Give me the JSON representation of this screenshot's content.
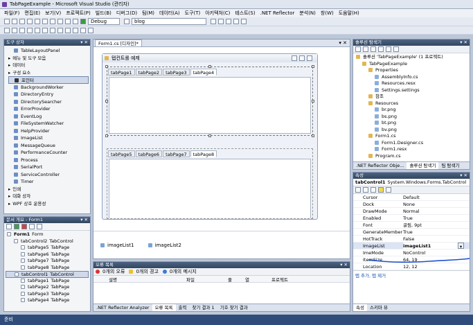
{
  "window": {
    "title": "TabPageExample - Microsoft Visual Studio (관리자)"
  },
  "menu": [
    "파일(F)",
    "편집(E)",
    "보기(V)",
    "프로젝트(P)",
    "빌드(B)",
    "디버그(D)",
    "팀(M)",
    "데이터(A)",
    "도구(T)",
    "아키텍처(C)",
    "테스트(S)",
    ".NET Reflector",
    "분석(N)",
    "창(W)",
    "도움말(H)"
  ],
  "toolbar": {
    "config": "Debug",
    "find": "blog"
  },
  "toolbox": {
    "title": "도구 상자",
    "items": [
      {
        "label": "TableLayoutPanel",
        "kind": "item"
      },
      {
        "label": "메뉴 및 도구 모음",
        "kind": "cat"
      },
      {
        "label": "데이터",
        "kind": "cat"
      },
      {
        "label": "구성 요소",
        "kind": "cat"
      },
      {
        "label": "포인터",
        "kind": "sel"
      },
      {
        "label": "BackgroundWorker",
        "kind": "item"
      },
      {
        "label": "DirectoryEntry",
        "kind": "item"
      },
      {
        "label": "DirectorySearcher",
        "kind": "item"
      },
      {
        "label": "ErrorProvider",
        "kind": "item"
      },
      {
        "label": "EventLog",
        "kind": "item"
      },
      {
        "label": "FileSystemWatcher",
        "kind": "item"
      },
      {
        "label": "HelpProvider",
        "kind": "item"
      },
      {
        "label": "ImageList",
        "kind": "item"
      },
      {
        "label": "MessageQueue",
        "kind": "item"
      },
      {
        "label": "PerformanceCounter",
        "kind": "item"
      },
      {
        "label": "Process",
        "kind": "item"
      },
      {
        "label": "SerialPort",
        "kind": "item"
      },
      {
        "label": "ServiceController",
        "kind": "item"
      },
      {
        "label": "Timer",
        "kind": "item"
      },
      {
        "label": "인쇄",
        "kind": "cat"
      },
      {
        "label": "대화 상자",
        "kind": "cat"
      },
      {
        "label": "WPF 상호 운용성",
        "kind": "cat"
      }
    ]
  },
  "outline": {
    "title": "문서 개요 - Form1",
    "items": [
      {
        "name": "Form1",
        "type": "Form",
        "indent": 0
      },
      {
        "name": "tabControl2",
        "type": "TabControl",
        "indent": 1
      },
      {
        "name": "tabPage5",
        "type": "TabPage",
        "indent": 2
      },
      {
        "name": "tabPage6",
        "type": "TabPage",
        "indent": 2
      },
      {
        "name": "tabPage7",
        "type": "TabPage",
        "indent": 2
      },
      {
        "name": "tabPage8",
        "type": "TabPage",
        "indent": 2
      },
      {
        "name": "tabControl1",
        "type": "TabControl",
        "indent": 1,
        "sel": true
      },
      {
        "name": "tabPage1",
        "type": "TabPage",
        "indent": 2
      },
      {
        "name": "tabPage2",
        "type": "TabPage",
        "indent": 2
      },
      {
        "name": "tabPage3",
        "type": "TabPage",
        "indent": 2
      },
      {
        "name": "tabPage4",
        "type": "TabPage",
        "indent": 2
      }
    ]
  },
  "designer": {
    "tab": "Form1.cs [디자인]*",
    "form_title": "탭컨트롤 예제",
    "tabs1": [
      "tabPage1",
      "tabPage2",
      "tabPage3",
      "tabPage4"
    ],
    "tabs2": [
      "tabPage5",
      "tabPage6",
      "tabPage7",
      "tabPage8"
    ],
    "tray": [
      "imageList1",
      "imageList2"
    ]
  },
  "errors": {
    "title": "오류 목록",
    "filters": [
      "0개의 오류",
      "0개의 경고",
      "0개의 메시지"
    ],
    "cols": [
      "설명",
      "파일",
      "줄",
      "열",
      "프로젝트"
    ],
    "tabs": [
      ".NET Reflector Analyzer",
      "오류 목록",
      "출력",
      "찾기 결과 1",
      "기호 찾기 결과"
    ]
  },
  "solution": {
    "title": "솔루션 탐색기",
    "items": [
      {
        "label": "솔루션 'TabPageExample' (1 프로젝트)",
        "indent": 0
      },
      {
        "label": "TabPageExample",
        "indent": 1
      },
      {
        "label": "Properties",
        "indent": 2
      },
      {
        "label": "AssemblyInfo.cs",
        "indent": 3
      },
      {
        "label": "Resources.resx",
        "indent": 3
      },
      {
        "label": "Settings.settings",
        "indent": 3
      },
      {
        "label": "참조",
        "indent": 2
      },
      {
        "label": "Resources",
        "indent": 2
      },
      {
        "label": "br.png",
        "indent": 3
      },
      {
        "label": "bs.png",
        "indent": 3
      },
      {
        "label": "bt.png",
        "indent": 3
      },
      {
        "label": "bv.png",
        "indent": 3
      },
      {
        "label": "Form1.cs",
        "indent": 2
      },
      {
        "label": "Form1.Designer.cs",
        "indent": 3
      },
      {
        "label": "Form1.resx",
        "indent": 3
      },
      {
        "label": "Program.cs",
        "indent": 2
      }
    ],
    "tabs": [
      ".NET Reflector Obje...",
      "솔루션 탐색기",
      "팀 탐색기"
    ]
  },
  "props": {
    "title": "속성",
    "object": "tabControl1",
    "objtype": "System.Windows.Forms.TabControl",
    "rows": [
      {
        "k": "Cursor",
        "v": "Default"
      },
      {
        "k": "Dock",
        "v": "None"
      },
      {
        "k": "DrawMode",
        "v": "Normal"
      },
      {
        "k": "Enabled",
        "v": "True"
      },
      {
        "k": "Font",
        "v": "굴림, 9pt"
      },
      {
        "k": "GenerateMember",
        "v": "True"
      },
      {
        "k": "HotTrack",
        "v": "False"
      },
      {
        "k": "ImageList",
        "v": "imageList1",
        "sel": true
      },
      {
        "k": "ImeMode",
        "v": "NoControl"
      },
      {
        "k": "ItemSize",
        "v": "64, 19"
      },
      {
        "k": "Location",
        "v": "12, 12"
      }
    ],
    "link": "탭 추가, 탭 제거",
    "tabs": [
      "속성",
      "스키마 뷰"
    ]
  },
  "status": {
    "text": "준비"
  },
  "colors": {
    "accent": "#3c66c4",
    "annotation": "#1e50d0"
  }
}
